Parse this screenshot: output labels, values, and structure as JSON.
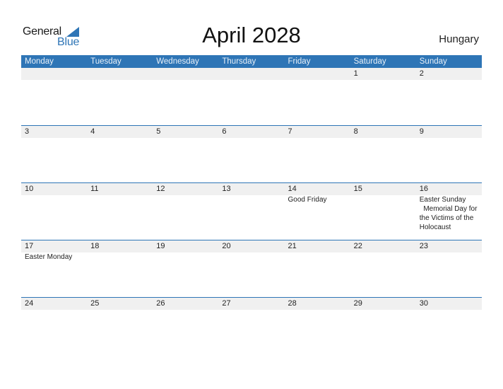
{
  "logo": {
    "general": "General",
    "blue": "Blue"
  },
  "header": {
    "title": "April 2028",
    "country": "Hungary"
  },
  "weekdays": [
    "Monday",
    "Tuesday",
    "Wednesday",
    "Thursday",
    "Friday",
    "Saturday",
    "Sunday"
  ],
  "weeks": [
    {
      "days": [
        {
          "date": "",
          "events": []
        },
        {
          "date": "",
          "events": []
        },
        {
          "date": "",
          "events": []
        },
        {
          "date": "",
          "events": []
        },
        {
          "date": "",
          "events": []
        },
        {
          "date": "1",
          "events": []
        },
        {
          "date": "2",
          "events": []
        }
      ]
    },
    {
      "days": [
        {
          "date": "3",
          "events": []
        },
        {
          "date": "4",
          "events": []
        },
        {
          "date": "5",
          "events": []
        },
        {
          "date": "6",
          "events": []
        },
        {
          "date": "7",
          "events": []
        },
        {
          "date": "8",
          "events": []
        },
        {
          "date": "9",
          "events": []
        }
      ]
    },
    {
      "days": [
        {
          "date": "10",
          "events": []
        },
        {
          "date": "11",
          "events": []
        },
        {
          "date": "12",
          "events": []
        },
        {
          "date": "13",
          "events": []
        },
        {
          "date": "14",
          "events": [
            "Good Friday"
          ]
        },
        {
          "date": "15",
          "events": []
        },
        {
          "date": "16",
          "events": [
            "Easter Sunday",
            "  Memorial Day for the Victims of the Holocaust"
          ]
        }
      ]
    },
    {
      "days": [
        {
          "date": "17",
          "events": [
            "Easter Monday"
          ]
        },
        {
          "date": "18",
          "events": []
        },
        {
          "date": "19",
          "events": []
        },
        {
          "date": "20",
          "events": []
        },
        {
          "date": "21",
          "events": []
        },
        {
          "date": "22",
          "events": []
        },
        {
          "date": "23",
          "events": []
        }
      ]
    },
    {
      "days": [
        {
          "date": "24",
          "events": []
        },
        {
          "date": "25",
          "events": []
        },
        {
          "date": "26",
          "events": []
        },
        {
          "date": "27",
          "events": []
        },
        {
          "date": "28",
          "events": []
        },
        {
          "date": "29",
          "events": []
        },
        {
          "date": "30",
          "events": []
        }
      ]
    }
  ],
  "colors": {
    "accent": "#2e75b6",
    "strip": "#f0f0f0"
  }
}
